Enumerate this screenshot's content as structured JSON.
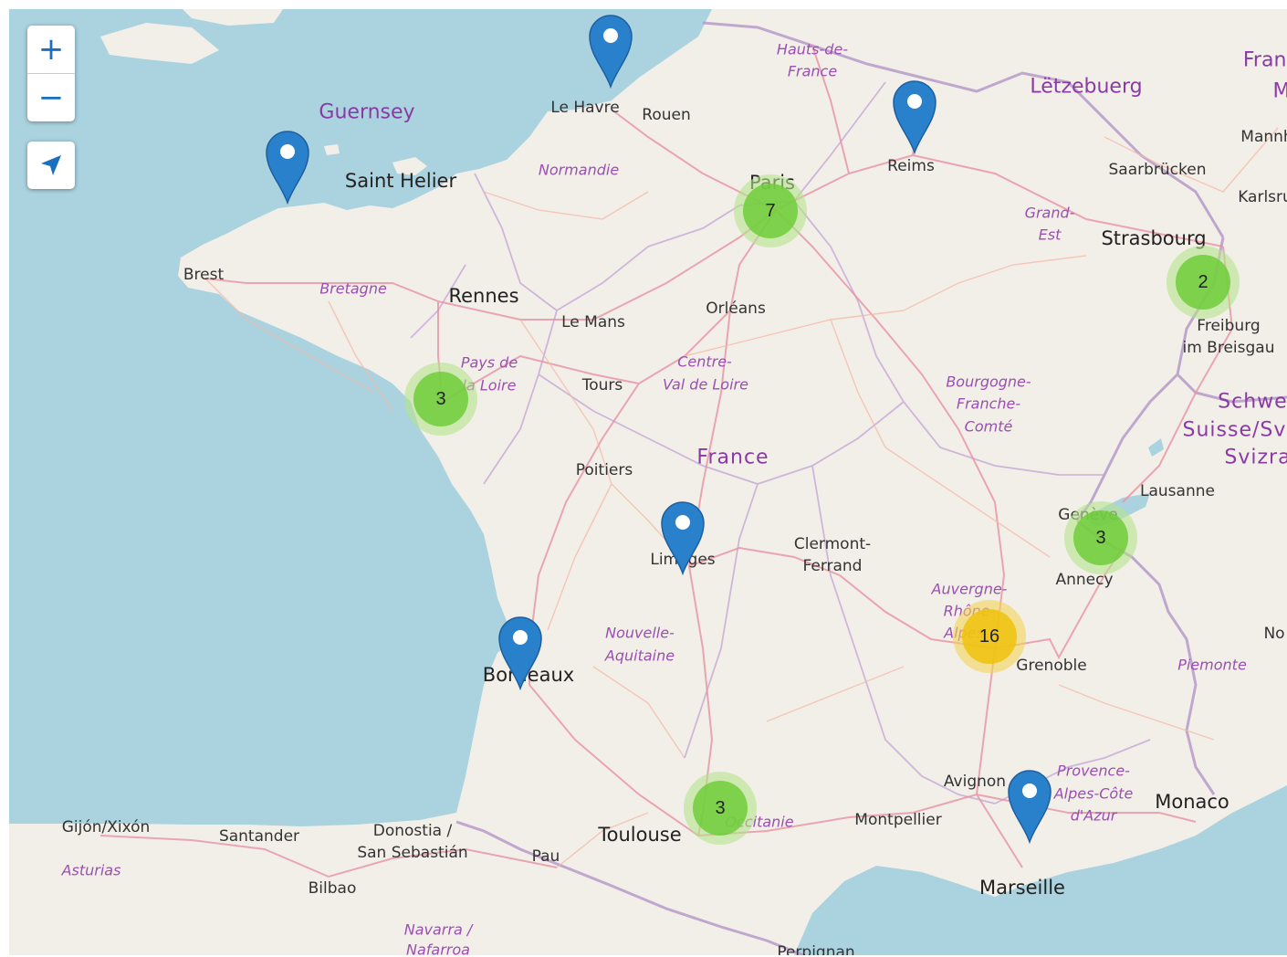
{
  "controls": {
    "zoom_in": "+",
    "zoom_out": "−",
    "locate_icon": "locate-arrow"
  },
  "labels": {
    "le_havre": "Le Havre",
    "rouen": "Rouen",
    "hauts_de_france": "Hauts-de-France",
    "hdf_1": "Hauts-de-",
    "hdf_2": "France",
    "letzebuerg": "Lëtzebuerg",
    "frank": "Frank",
    "m": "M",
    "mannh": "Mannh",
    "saarbrucken": "Saarbrücken",
    "karlsru": "Karlsru",
    "guernsey": "Guernsey",
    "saint_helier": "Saint Helier",
    "normandie": "Normandie",
    "reims": "Reims",
    "paris": "Paris",
    "grand_est_1": "Grand-",
    "grand_est_2": "Est",
    "strasbourg": "Strasbourg",
    "brest": "Brest",
    "bretagne": "Bretagne",
    "rennes": "Rennes",
    "le_mans": "Le Mans",
    "orleans": "Orléans",
    "freiburg_1": "Freiburg",
    "freiburg_2": "im Breisgau",
    "pays_1": "Pays de",
    "pays_2": "la Loire",
    "tours": "Tours",
    "centre_1": "Centre-",
    "centre_2": "Val de Loire",
    "bfc_1": "Bourgogne-",
    "bfc_2": "Franche-",
    "bfc_3": "Comté",
    "schwei": "Schwei",
    "suisse": "Suisse/Svi",
    "svizra": "Svizra",
    "france": "France",
    "poitiers": "Poitiers",
    "lausanne": "Lausanne",
    "geneve": "Genève",
    "limoges": "Limoges",
    "clermont_1": "Clermont-",
    "clermont_2": "Ferrand",
    "annecy": "Annecy",
    "ara_1": "Auvergne-",
    "ara_2": "Rhône-",
    "ara_3": "Alpes",
    "no": "No",
    "na_1": "Nouvelle-",
    "na_2": "Aquitaine",
    "bordeaux": "Bordeaux",
    "grenoble": "Grenoble",
    "piemonte": "Piemonte",
    "avignon": "Avignon",
    "paca_1": "Provence-",
    "paca_2": "Alpes-Côte",
    "paca_3": "d'Azur",
    "gijon": "Gijón/Xixón",
    "santander": "Santander",
    "donostia_1": "Donostia /",
    "donostia_2": "San Sebastián",
    "toulouse": "Toulouse",
    "occitanie": "Occitanie",
    "montpellier": "Montpellier",
    "monaco": "Monaco",
    "asturias": "Asturias",
    "pau": "Pau",
    "bilbao": "Bilbao",
    "marseille": "Marseille",
    "navarra_1": "Navarra /",
    "navarra_2": "Nafarroa",
    "perpignan": "Perpignan"
  },
  "clusters": [
    {
      "count": "7",
      "level": "small"
    },
    {
      "count": "2",
      "level": "small"
    },
    {
      "count": "3",
      "level": "small"
    },
    {
      "count": "3",
      "level": "small"
    },
    {
      "count": "16",
      "level": "medium"
    },
    {
      "count": "3",
      "level": "small"
    }
  ],
  "markers": [
    "Brittany coast",
    "Le Havre",
    "Reims",
    "Limoges",
    "Bordeaux",
    "Marseille"
  ],
  "colors": {
    "sea": "#aad3df",
    "land": "#f2efe9",
    "cluster_small": "#6ecc39",
    "cluster_medium": "#f0c20c",
    "marker": "#2a81cb",
    "control": "#1a6fbf"
  }
}
